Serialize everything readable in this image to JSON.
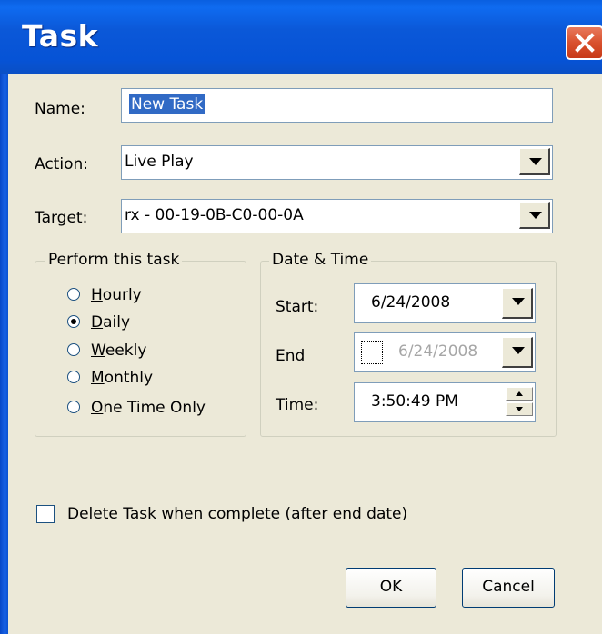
{
  "window": {
    "title": "Task"
  },
  "form": {
    "name_label": "Name:",
    "name_value": "New Task",
    "action_label": "Action:",
    "action_value": "Live Play",
    "target_label": "Target:",
    "target_value": "rx - 00-19-0B-C0-00-0A"
  },
  "perform": {
    "legend": "Perform this task",
    "options": [
      {
        "label": "Hourly",
        "mnemonic": "H",
        "rest": "ourly",
        "selected": false
      },
      {
        "label": "Daily",
        "mnemonic": "D",
        "rest": "aily",
        "selected": true
      },
      {
        "label": "Weekly",
        "mnemonic": "W",
        "rest": "eekly",
        "selected": false
      },
      {
        "label": "Monthly",
        "mnemonic": "M",
        "rest": "onthly",
        "selected": false
      },
      {
        "label": "One Time Only",
        "mnemonic": "O",
        "rest": "ne Time Only",
        "selected": false
      }
    ]
  },
  "datetime": {
    "legend": "Date & Time",
    "start_label": "Start:",
    "start_value": "6/24/2008",
    "end_label": "End",
    "end_value": "6/24/2008",
    "end_checked": false,
    "time_label": "Time:",
    "time_value": "3:50:49 PM"
  },
  "options": {
    "delete_label": "Delete Task when complete (after end date)",
    "delete_checked": false
  },
  "buttons": {
    "ok": "OK",
    "cancel": "Cancel"
  },
  "icons": {
    "close": "close-icon",
    "dropdown": "chevron-down-icon",
    "spin_up": "spin-up-icon",
    "spin_down": "spin-down-icon"
  },
  "colors": {
    "titlebar": "#0A5FE0",
    "dialog_bg": "#ECE9D8",
    "close": "#D9512E",
    "selection": "#316AC5"
  }
}
